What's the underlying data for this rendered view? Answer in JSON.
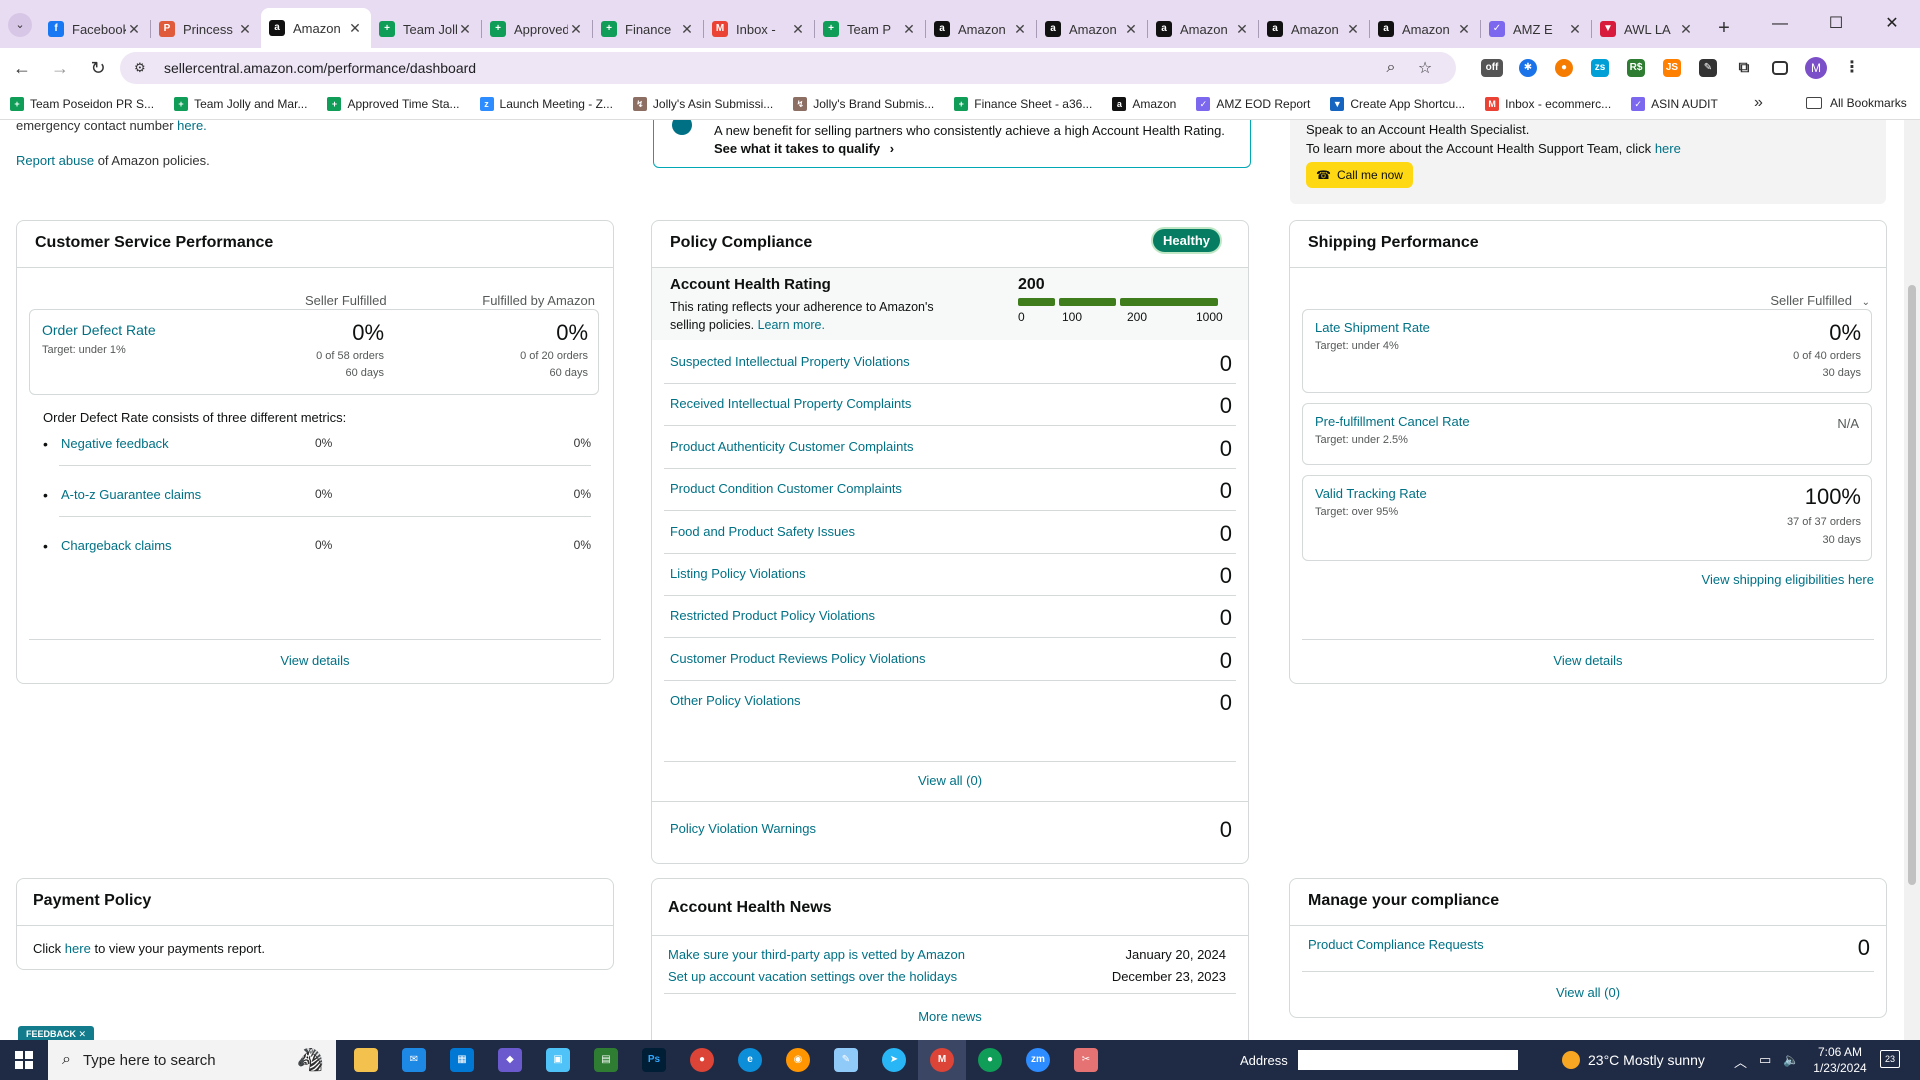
{
  "browser": {
    "tabs": [
      {
        "label": "Facebook",
        "icon": "facebook-icon",
        "color": "#1877f2",
        "glyph": "f"
      },
      {
        "label": "Princess",
        "icon": "princess-icon",
        "color": "#e05b3b",
        "glyph": "P"
      },
      {
        "label": "Amazon",
        "icon": "amazon-icon",
        "color": "#111111",
        "glyph": "a",
        "active": true
      },
      {
        "label": "Team Jolly",
        "icon": "sheets-icon",
        "color": "#0f9d58",
        "glyph": "+"
      },
      {
        "label": "Approved",
        "icon": "sheets-icon",
        "color": "#0f9d58",
        "glyph": "+"
      },
      {
        "label": "Finance",
        "icon": "sheets-icon",
        "color": "#0f9d58",
        "glyph": "+"
      },
      {
        "label": "Inbox -",
        "icon": "gmail-icon",
        "color": "#ea4335",
        "glyph": "M"
      },
      {
        "label": "Team P",
        "icon": "sheets-icon",
        "color": "#0f9d58",
        "glyph": "+"
      },
      {
        "label": "Amazon",
        "icon": "amazon-icon",
        "color": "#111111",
        "glyph": "a"
      },
      {
        "label": "Amazon",
        "icon": "amazon-icon",
        "color": "#111111",
        "glyph": "a"
      },
      {
        "label": "Amazon",
        "icon": "amazon-icon",
        "color": "#111111",
        "glyph": "a"
      },
      {
        "label": "Amazon",
        "icon": "amazon-icon",
        "color": "#111111",
        "glyph": "a"
      },
      {
        "label": "Amazon",
        "icon": "amazon-icon",
        "color": "#111111",
        "glyph": "a"
      },
      {
        "label": "AMZ E",
        "icon": "clickup-icon",
        "color": "#7b68ee",
        "glyph": "✓"
      },
      {
        "label": "AWL LA",
        "icon": "awl-icon",
        "color": "#d81b3c",
        "glyph": "▼"
      }
    ],
    "url": "sellercentral.amazon.com/performance/dashboard",
    "bookmarks": [
      {
        "label": "Team Poseidon PR S...",
        "icon": "sheets-icon",
        "color": "#0f9d58",
        "glyph": "+"
      },
      {
        "label": "Team Jolly and Mar...",
        "icon": "sheets-icon",
        "color": "#0f9d58",
        "glyph": "+"
      },
      {
        "label": "Approved Time Sta...",
        "icon": "sheets-icon",
        "color": "#0f9d58",
        "glyph": "+"
      },
      {
        "label": "Launch Meeting - Z...",
        "icon": "zoom-icon",
        "color": "#2d8cff",
        "glyph": "z"
      },
      {
        "label": "Jolly's Asin Submissi...",
        "icon": "form-icon",
        "color": "#8d6e63",
        "glyph": "↯"
      },
      {
        "label": "Jolly's Brand Submis...",
        "icon": "form-icon",
        "color": "#8d6e63",
        "glyph": "↯"
      },
      {
        "label": "Finance Sheet - a36...",
        "icon": "sheets-icon",
        "color": "#0f9d58",
        "glyph": "+"
      },
      {
        "label": "Amazon",
        "icon": "amazon-icon",
        "color": "#111111",
        "glyph": "a"
      },
      {
        "label": "AMZ EOD Report",
        "icon": "clickup-icon",
        "color": "#7b68ee",
        "glyph": "✓"
      },
      {
        "label": "Create App Shortcu...",
        "icon": "filter-icon",
        "color": "#1565c0",
        "glyph": "▼"
      },
      {
        "label": "Inbox - ecommerc...",
        "icon": "gmail-icon",
        "color": "#ea4335",
        "glyph": "M"
      },
      {
        "label": "ASIN AUDIT",
        "icon": "clickup-icon",
        "color": "#7b68ee",
        "glyph": "✓"
      }
    ],
    "all_bookmarks": "All Bookmarks",
    "profile_initial": "M"
  },
  "top": {
    "emergency_text": "emergency contact number",
    "emergency_link": "here.",
    "report_link": "Report abuse",
    "report_text": "of Amazon policies.",
    "benefit_text": "A new benefit for selling partners who consistently achieve a high Account Health Rating.",
    "benefit_link": "See what it takes to qualify",
    "specialist_line": "Speak to an Account Health Specialist.",
    "support_text": "To learn more about the Account Health Support Team, click",
    "support_link": "here",
    "call_button": "Call me now"
  },
  "customer_service": {
    "title": "Customer Service Performance",
    "col_seller": "Seller Fulfilled",
    "col_fba": "Fulfilled by Amazon",
    "odr_label": "Order Defect Rate",
    "odr_target": "Target: under 1%",
    "seller_pct": "0%",
    "seller_orders": "0 of 58 orders",
    "seller_days": "60 days",
    "fba_pct": "0%",
    "fba_orders": "0 of 20 orders",
    "fba_days": "60 days",
    "metrics_intro": "Order Defect Rate consists of three different metrics:",
    "metrics": [
      {
        "label": "Negative feedback",
        "seller": "0%",
        "fba": "0%"
      },
      {
        "label": "A-to-z Guarantee claims",
        "seller": "0%",
        "fba": "0%"
      },
      {
        "label": "Chargeback claims",
        "seller": "0%",
        "fba": "0%"
      }
    ],
    "view_details": "View details"
  },
  "policy": {
    "title": "Policy Compliance",
    "badge": "Healthy",
    "ahr_title": "Account Health Rating",
    "ahr_desc": "This rating reflects your adherence to Amazon's selling policies.",
    "ahr_learn": "Learn more.",
    "ahr_value": "200",
    "scale": [
      "0",
      "100",
      "200",
      "1000"
    ],
    "rating_fraction": 0.2,
    "rows": [
      {
        "label": "Suspected Intellectual Property Violations",
        "count": "0"
      },
      {
        "label": "Received Intellectual Property Complaints",
        "count": "0"
      },
      {
        "label": "Product Authenticity Customer Complaints",
        "count": "0"
      },
      {
        "label": "Product Condition Customer Complaints",
        "count": "0"
      },
      {
        "label": "Food and Product Safety Issues",
        "count": "0"
      },
      {
        "label": "Listing Policy Violations",
        "count": "0"
      },
      {
        "label": "Restricted Product Policy Violations",
        "count": "0"
      },
      {
        "label": "Customer Product Reviews Policy Violations",
        "count": "0"
      },
      {
        "label": "Other Policy Violations",
        "count": "0"
      }
    ],
    "view_all": "View all (0)",
    "warnings_label": "Policy Violation Warnings",
    "warnings_count": "0"
  },
  "shipping": {
    "title": "Shipping Performance",
    "filter": "Seller Fulfilled",
    "late_label": "Late Shipment Rate",
    "late_target": "Target: under 4%",
    "late_value": "0%",
    "late_orders": "0 of 40 orders",
    "late_days": "30 days",
    "cancel_label": "Pre-fulfillment Cancel Rate",
    "cancel_target": "Target: under 2.5%",
    "cancel_value": "N/A",
    "tracking_label": "Valid Tracking Rate",
    "tracking_target": "Target: over 95%",
    "tracking_value": "100%",
    "tracking_orders": "37 of 37 orders",
    "tracking_days": "30 days",
    "eligibility_link": "View shipping eligibilities here",
    "view_details": "View details"
  },
  "payment": {
    "title": "Payment Policy",
    "text_before": "Click",
    "link": "here",
    "text_after": "to view your payments report."
  },
  "news": {
    "title": "Account Health News",
    "items": [
      {
        "label": "Make sure your third-party app is vetted by Amazon",
        "date": "January 20, 2024"
      },
      {
        "label": "Set up account vacation settings over the holidays",
        "date": "December 23, 2023"
      }
    ],
    "more": "More news"
  },
  "compliance": {
    "title": "Manage your compliance",
    "row_label": "Product Compliance Requests",
    "row_count": "0",
    "view_all": "View all (0)"
  },
  "feedback": "FEEDBACK",
  "taskbar": {
    "search_placeholder": "Type here to search",
    "address_label": "Address",
    "weather": "23°C  Mostly sunny",
    "time": "7:06 AM",
    "date": "1/23/2024",
    "notification_count": "23"
  },
  "colors": {
    "link": "#007185",
    "healthy": "#067d62",
    "call_button": "#ffd814",
    "tab_bar": "#e8dcf2"
  }
}
